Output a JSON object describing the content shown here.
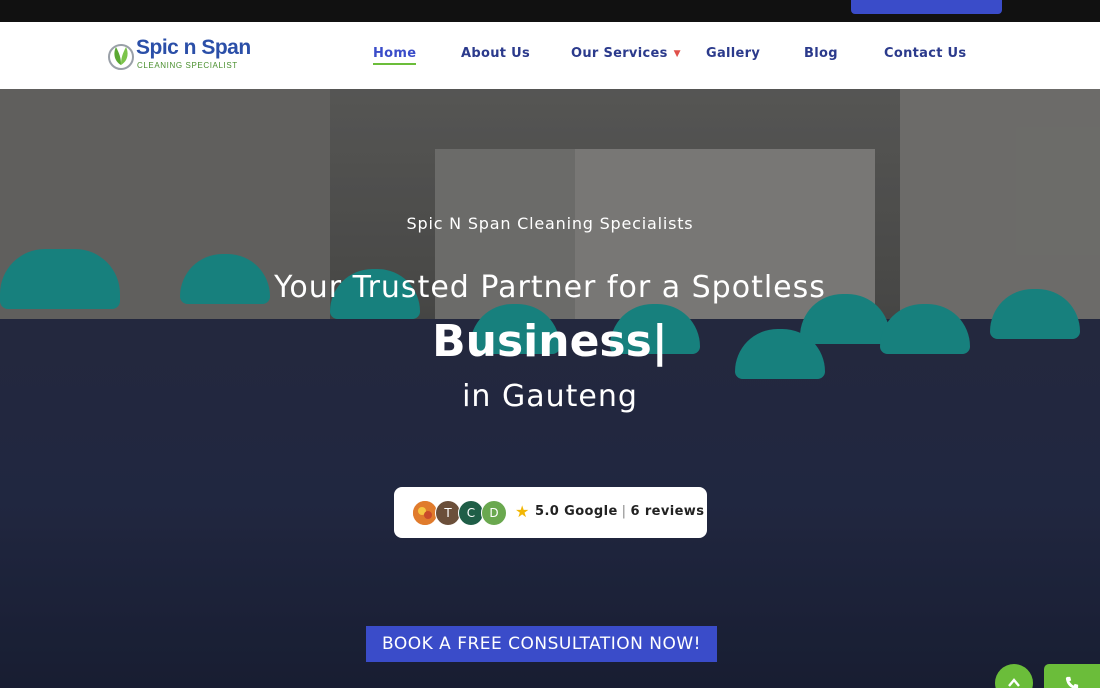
{
  "brand": {
    "name": "Spic n Span",
    "tagline": "CLEANING SPECIALIST"
  },
  "nav": {
    "items": [
      {
        "label": "Home",
        "active": true
      },
      {
        "label": "About Us"
      },
      {
        "label": "Our Services",
        "has_dropdown": true
      },
      {
        "label": "Gallery"
      },
      {
        "label": "Blog"
      },
      {
        "label": "Contact Us"
      }
    ]
  },
  "hero": {
    "subtitle": "Spic N Span Cleaning Specialists",
    "line1": "Your Trusted Partner for a Spotless",
    "rotating_word": "Business",
    "cursor": "|",
    "line3": "in Gauteng"
  },
  "reviews": {
    "avatars": [
      {
        "letter": "",
        "color": "#e07b2c"
      },
      {
        "letter": "T",
        "color": "#6b4f3a"
      },
      {
        "letter": "C",
        "color": "#1f5e47"
      },
      {
        "letter": "D",
        "color": "#6aa84f"
      }
    ],
    "rating": "5.0 Google",
    "separator": "|",
    "count": "6 reviews"
  },
  "cta": {
    "label": "BOOK A FREE CONSULTATION NOW!"
  },
  "floating": {
    "scroll_top_icon": "chevron-up-icon",
    "phone_icon": "phone-icon"
  },
  "colors": {
    "primary": "#3a4cc9",
    "accent_green": "#6bbd3a",
    "nav_text": "#2b3a8c"
  }
}
